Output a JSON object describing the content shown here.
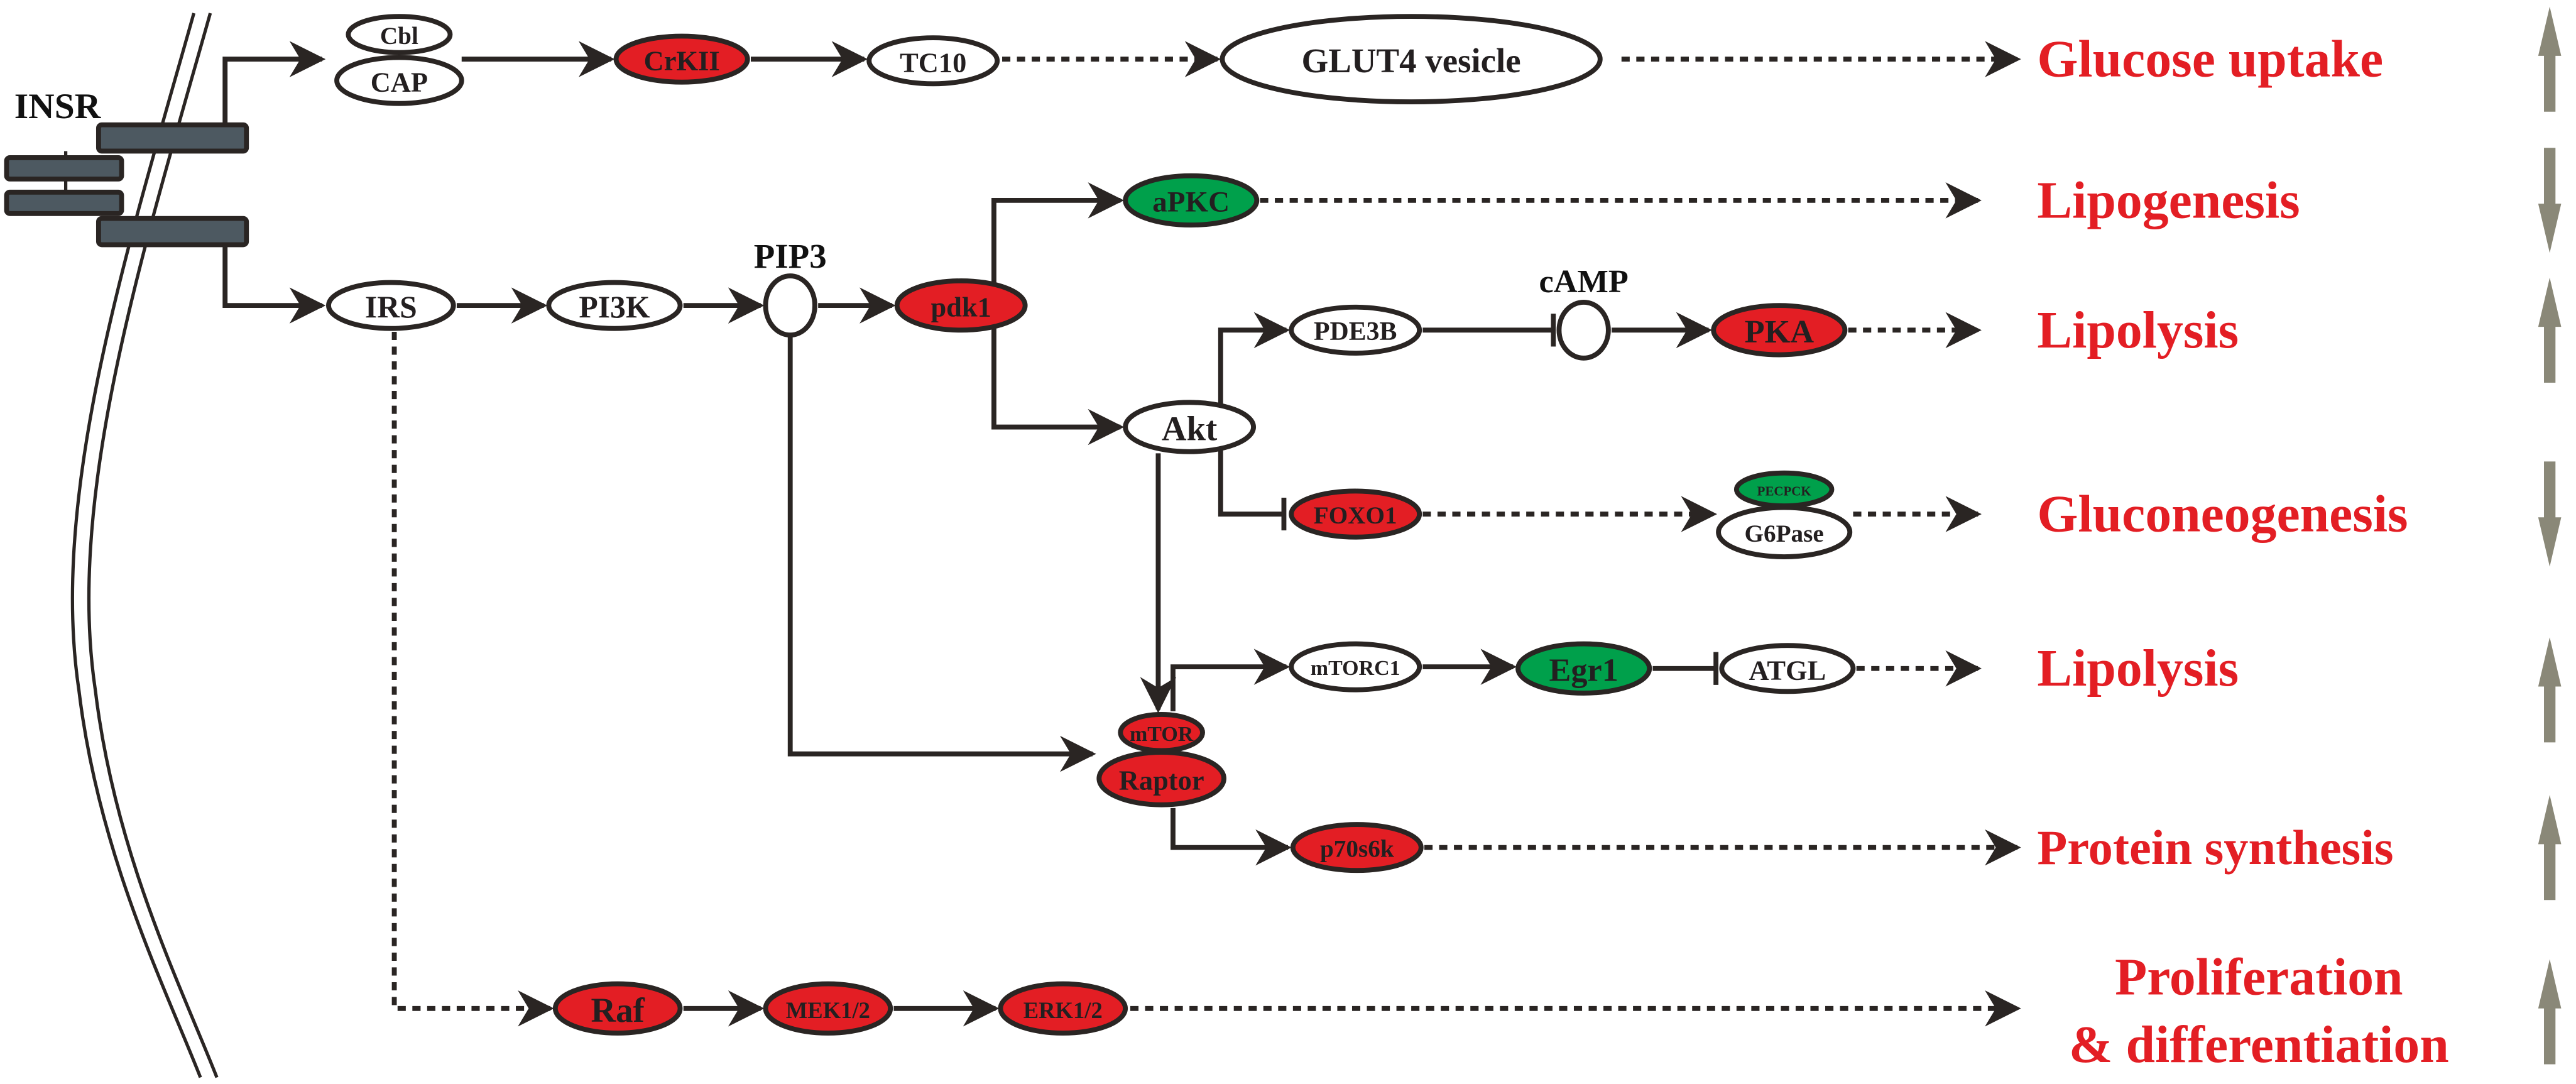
{
  "receptor": {
    "label": "INSR"
  },
  "colors": {
    "upregulated": "#e31e24",
    "downregulated": "#00a04b",
    "neutral": "#ffffff",
    "outcome_text": "#e31e24",
    "trend_arrow": "#8a8878",
    "line": "#2a2523"
  },
  "small_molecules": [
    {
      "id": "pip3",
      "label": "PIP3"
    },
    {
      "id": "camp",
      "label": "cAMP"
    }
  ],
  "nodes": [
    {
      "id": "cbl",
      "label": "Cbl",
      "status": "neutral"
    },
    {
      "id": "cap",
      "label": "CAP",
      "status": "neutral"
    },
    {
      "id": "crkii",
      "label": "CrKII",
      "status": "upregulated"
    },
    {
      "id": "tc10",
      "label": "TC10",
      "status": "neutral"
    },
    {
      "id": "glut4",
      "label": "GLUT4 vesicle",
      "status": "neutral"
    },
    {
      "id": "irs",
      "label": "IRS",
      "status": "neutral"
    },
    {
      "id": "pi3k",
      "label": "PI3K",
      "status": "neutral"
    },
    {
      "id": "pdk1",
      "label": "pdk1",
      "status": "upregulated"
    },
    {
      "id": "apkc",
      "label": "aPKC",
      "status": "downregulated"
    },
    {
      "id": "akt",
      "label": "Akt",
      "status": "neutral"
    },
    {
      "id": "pde3b",
      "label": "PDE3B",
      "status": "neutral"
    },
    {
      "id": "pka",
      "label": "PKA",
      "status": "upregulated"
    },
    {
      "id": "foxo1",
      "label": "FOXO1",
      "status": "upregulated"
    },
    {
      "id": "pecpck",
      "label": "PECPCK",
      "status": "downregulated"
    },
    {
      "id": "g6pase",
      "label": "G6Pase",
      "status": "neutral"
    },
    {
      "id": "mtorc1",
      "label": "mTORC1",
      "status": "neutral"
    },
    {
      "id": "egr1",
      "label": "Egr1",
      "status": "downregulated"
    },
    {
      "id": "atgl",
      "label": "ATGL",
      "status": "neutral"
    },
    {
      "id": "mtor",
      "label": "mTOR",
      "status": "upregulated"
    },
    {
      "id": "raptor",
      "label": "Raptor",
      "status": "upregulated"
    },
    {
      "id": "p70s6k",
      "label": "p70s6k",
      "status": "upregulated"
    },
    {
      "id": "raf",
      "label": "Raf",
      "status": "upregulated"
    },
    {
      "id": "mek12",
      "label": "MEK1/2",
      "status": "upregulated"
    },
    {
      "id": "erk12",
      "label": "ERK1/2",
      "status": "upregulated"
    }
  ],
  "edges": [
    {
      "from": "insr",
      "to": "cap",
      "type": "activation"
    },
    {
      "from": "cap",
      "to": "crkii",
      "type": "activation"
    },
    {
      "from": "crkii",
      "to": "tc10",
      "type": "activation"
    },
    {
      "from": "tc10",
      "to": "glut4",
      "type": "indirect"
    },
    {
      "from": "glut4",
      "to": "glucose_uptake",
      "type": "indirect"
    },
    {
      "from": "insr",
      "to": "irs",
      "type": "activation"
    },
    {
      "from": "irs",
      "to": "pi3k",
      "type": "activation"
    },
    {
      "from": "pi3k",
      "to": "pip3",
      "type": "activation"
    },
    {
      "from": "pip3",
      "to": "pdk1",
      "type": "activation"
    },
    {
      "from": "pdk1",
      "to": "apkc",
      "type": "activation"
    },
    {
      "from": "apkc",
      "to": "lipogenesis",
      "type": "indirect"
    },
    {
      "from": "pdk1",
      "to": "akt",
      "type": "activation"
    },
    {
      "from": "akt",
      "to": "pde3b",
      "type": "activation"
    },
    {
      "from": "pde3b",
      "to": "camp",
      "type": "inhibition"
    },
    {
      "from": "camp",
      "to": "pka",
      "type": "activation"
    },
    {
      "from": "pka",
      "to": "lipolysis_1",
      "type": "indirect"
    },
    {
      "from": "akt",
      "to": "foxo1",
      "type": "inhibition"
    },
    {
      "from": "foxo1",
      "to": "g6pase",
      "type": "indirect"
    },
    {
      "from": "g6pase",
      "to": "gluconeogenesis",
      "type": "indirect"
    },
    {
      "from": "akt",
      "to": "mtor",
      "type": "activation"
    },
    {
      "from": "pip3",
      "to": "raptor",
      "type": "activation"
    },
    {
      "from": "raptor",
      "to": "mtorc1",
      "type": "activation"
    },
    {
      "from": "mtorc1",
      "to": "egr1",
      "type": "activation"
    },
    {
      "from": "egr1",
      "to": "atgl",
      "type": "inhibition"
    },
    {
      "from": "atgl",
      "to": "lipolysis_2",
      "type": "indirect"
    },
    {
      "from": "raptor",
      "to": "p70s6k",
      "type": "activation"
    },
    {
      "from": "p70s6k",
      "to": "protein_synthesis",
      "type": "indirect"
    },
    {
      "from": "irs",
      "to": "raf",
      "type": "indirect"
    },
    {
      "from": "raf",
      "to": "mek12",
      "type": "activation"
    },
    {
      "from": "mek12",
      "to": "erk12",
      "type": "activation"
    },
    {
      "from": "erk12",
      "to": "proliferation",
      "type": "indirect"
    }
  ],
  "outcomes": [
    {
      "id": "glucose_uptake",
      "lines": [
        "Glucose uptake"
      ],
      "trend": "up"
    },
    {
      "id": "lipogenesis",
      "lines": [
        "Lipogenesis"
      ],
      "trend": "down"
    },
    {
      "id": "lipolysis_1",
      "lines": [
        "Lipolysis"
      ],
      "trend": "up"
    },
    {
      "id": "gluconeogenesis",
      "lines": [
        "Gluconeogenesis"
      ],
      "trend": "down"
    },
    {
      "id": "lipolysis_2",
      "lines": [
        "Lipolysis"
      ],
      "trend": "up"
    },
    {
      "id": "protein_synthesis",
      "lines": [
        "Protein synthesis"
      ],
      "trend": "up"
    },
    {
      "id": "proliferation",
      "lines": [
        "Proliferation",
        "& differentiation"
      ],
      "trend": "up"
    }
  ]
}
